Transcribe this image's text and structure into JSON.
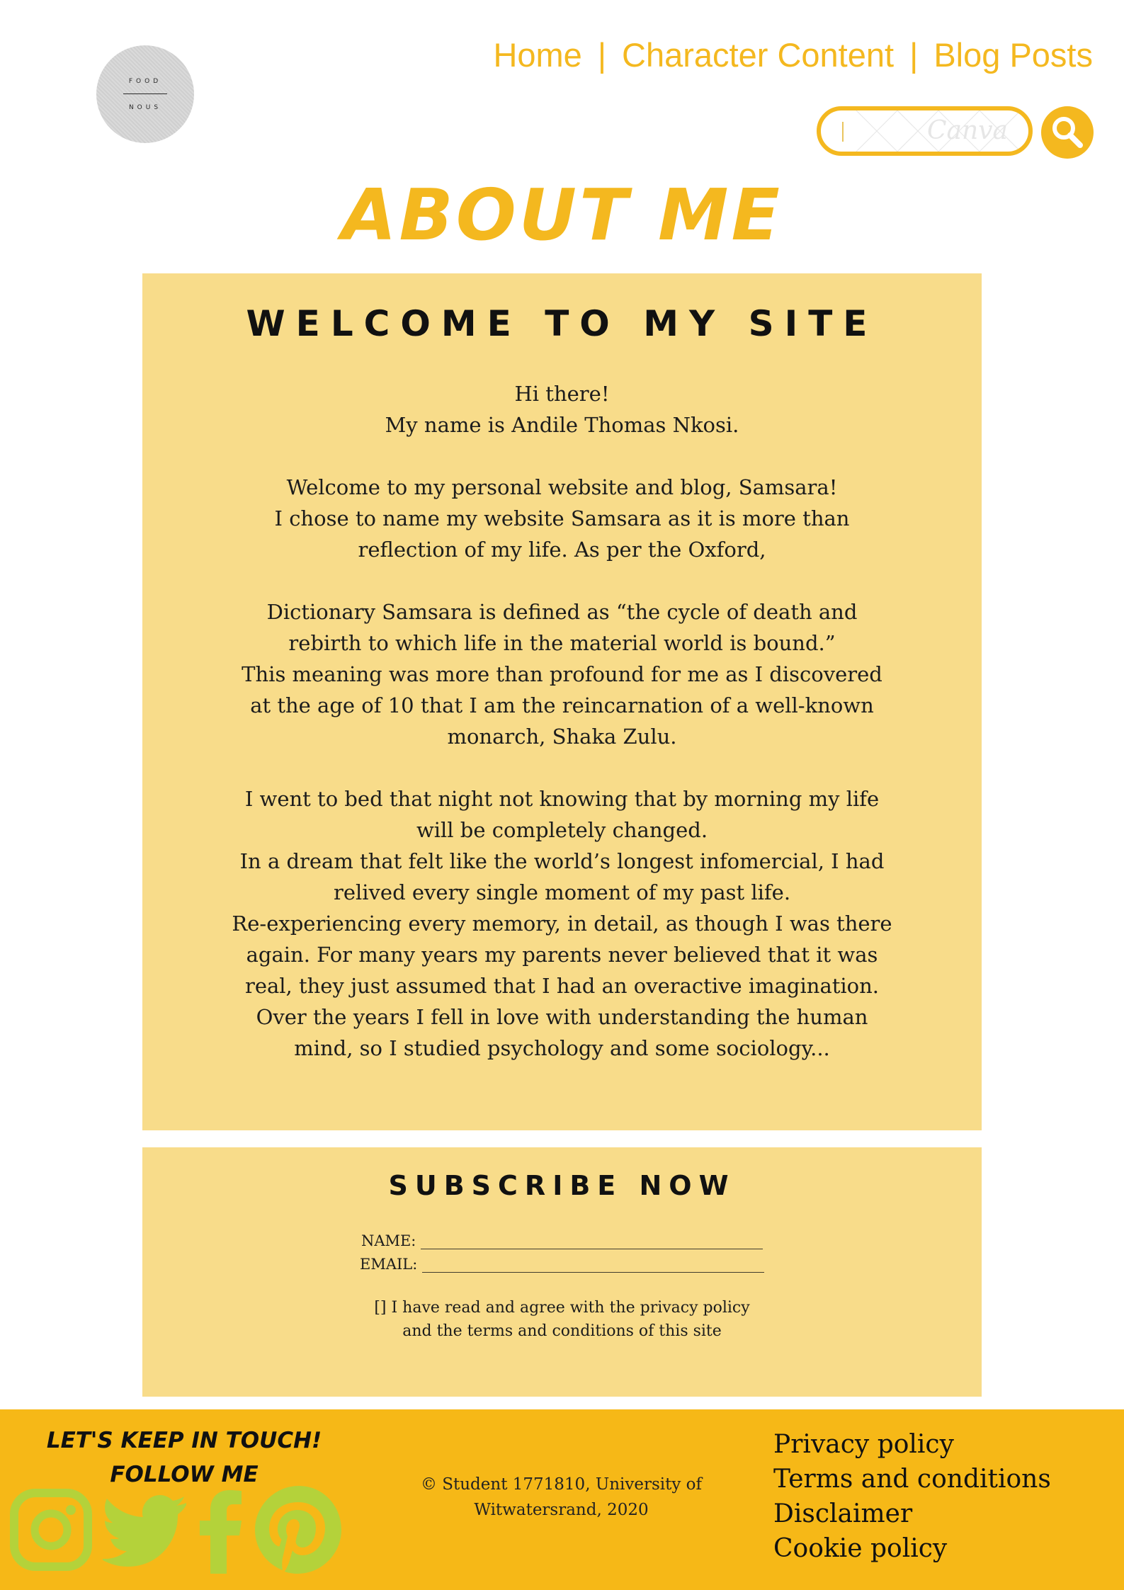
{
  "logo": {
    "top_word": "FOOD",
    "bottom_word": "NOUS"
  },
  "nav": {
    "items": [
      "Home",
      "Character Content",
      "Blog Posts"
    ],
    "separator": "|"
  },
  "search": {
    "watermark": "Canva"
  },
  "page_title": "ABOUT ME",
  "welcome": {
    "heading": "WELCOME TO MY SITE",
    "paragraphs": [
      [
        "Hi there!",
        "My name is Andile Thomas Nkosi."
      ],
      [
        "Welcome to my personal website and blog, Samsara!",
        "I chose to name my website Samsara as it is more than",
        "reflection of my life. As per the Oxford,"
      ],
      [
        "Dictionary Samsara is defined as “the cycle of death and",
        "rebirth to which life in the material world is bound.”",
        "This meaning was more than profound for me as I discovered",
        "at the age of 10 that I am the reincarnation of a well-known",
        "monarch, Shaka Zulu."
      ],
      [
        "I went to bed that night not knowing that by morning my life",
        "will be completely changed.",
        "In a dream that felt like the world’s longest infomercial, I had",
        "relived every single moment of my past life.",
        "Re-experiencing every memory, in detail, as though I was there",
        "again. For many years my parents never believed that it was",
        "real, they just assumed that I had an overactive imagination.",
        "Over the years I fell in love with understanding the human",
        "mind, so I studied psychology and some sociology..."
      ]
    ]
  },
  "subscribe": {
    "heading": "SUBSCRIBE NOW",
    "name_line": "NAME: ______________________________________________",
    "email_line": "EMAIL: ______________________________________________",
    "agree_line1": "[] I have read and agree with the privacy policy",
    "agree_line2": "and the terms and conditions of this site"
  },
  "footer": {
    "touch_line1": "LET'S KEEP IN TOUCH!",
    "touch_line2": "FOLLOW ME",
    "copyright_line1": "© Student 1771810, University of",
    "copyright_line2": "Witwatersrand, 2020",
    "links": [
      "Privacy policy",
      "Terms and conditions",
      "Disclaimer",
      "Cookie policy"
    ]
  },
  "colors": {
    "accent": "#f4b81f",
    "panel": "#f8dc8a",
    "footer": "#f6b817",
    "social": "#b4d23a"
  },
  "icons": [
    "search-icon",
    "instagram-icon",
    "twitter-icon",
    "facebook-icon",
    "pinterest-icon"
  ]
}
